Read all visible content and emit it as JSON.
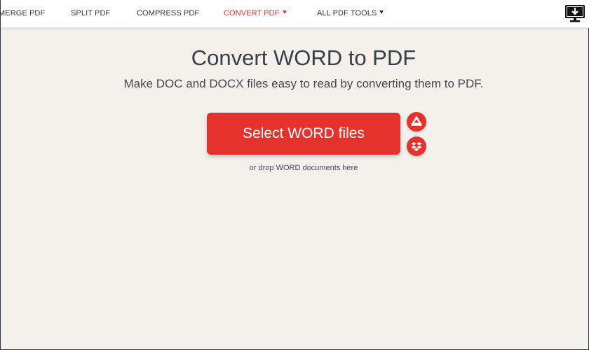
{
  "nav": {
    "items": [
      {
        "label": "MERGE PDF"
      },
      {
        "label": "SPLIT PDF"
      },
      {
        "label": "COMPRESS PDF"
      },
      {
        "label": "CONVERT PDF"
      },
      {
        "label": "ALL PDF TOOLS"
      }
    ],
    "desktop_icon": "desktop-download-icon"
  },
  "main": {
    "title": "Convert WORD to PDF",
    "subtitle": "Make DOC and DOCX files easy to read by converting them to PDF.",
    "select_button_label": "Select WORD files",
    "drop_hint": "or drop WORD documents here",
    "cloud_icons": [
      "google-drive-icon",
      "dropbox-icon"
    ]
  },
  "colors": {
    "accent": "#e5322d",
    "background": "#f4f1ec",
    "text": "#383e45"
  }
}
